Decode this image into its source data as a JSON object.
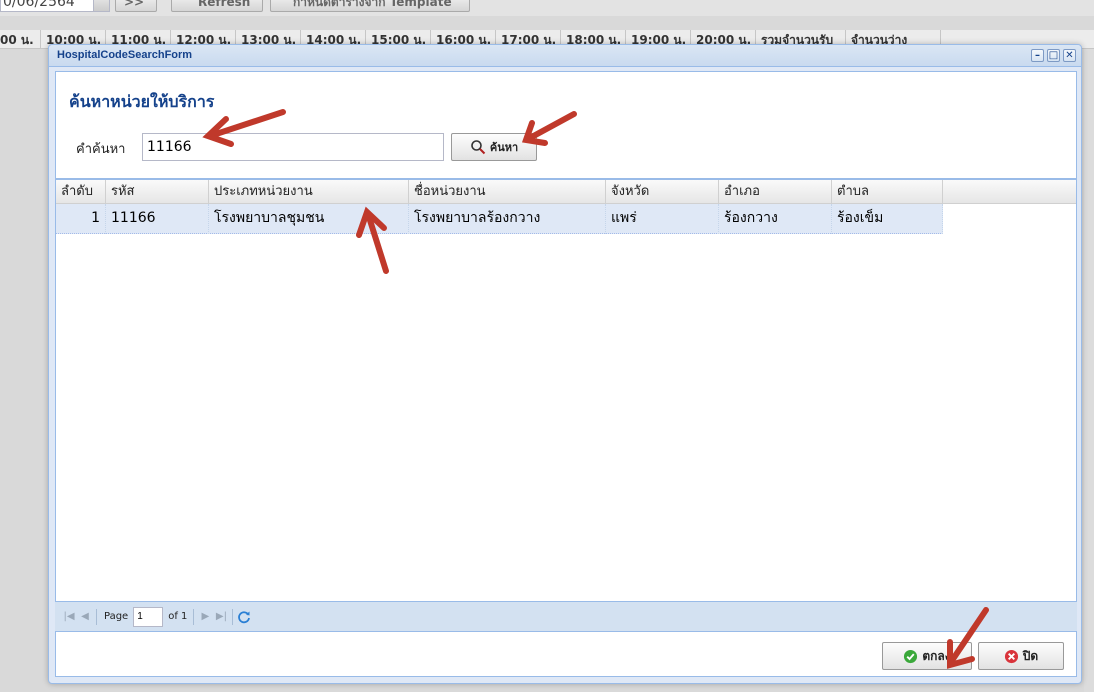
{
  "background": {
    "date_value": "0/06/2564",
    "next_label": ">>",
    "refresh_label": "Refresh",
    "template_label": "กำหนดตารางจาก Template",
    "hours": [
      "00 น.",
      "10:00 น.",
      "11:00 น.",
      "12:00 น.",
      "13:00 น.",
      "14:00 น.",
      "15:00 น.",
      "16:00 น.",
      "17:00 น.",
      "18:00 น.",
      "19:00 น.",
      "20:00 น.",
      "รวมจำนวนรับ",
      "จำนวนว่าง"
    ]
  },
  "window": {
    "title": "HospitalCodeSearchForm",
    "heading": "ค้นหาหน่วยให้บริการ",
    "search": {
      "label": "คำค้นหา",
      "value": "11166",
      "button_label": "ค้นหา"
    },
    "grid": {
      "columns": [
        "ลำดับ",
        "รหัส",
        "ประเภทหน่วยงาน",
        "ชื่อหน่วยงาน",
        "จังหวัด",
        "อำเภอ",
        "ตำบล"
      ],
      "rows": [
        {
          "no": "1",
          "code": "11166",
          "type": "โรงพยาบาลชุมชน",
          "name": "โรงพยาบาลร้องกวาง",
          "province": "แพร่",
          "district": "ร้องกวาง",
          "subdistrict": "ร้องเข็ม"
        }
      ]
    },
    "pager": {
      "page_label": "Page",
      "page_value": "1",
      "of_label": "of 1"
    },
    "footer": {
      "ok_label": "ตกลง",
      "close_label": "ปิด"
    }
  },
  "colors": {
    "title_blue": "#15428b",
    "selected_row": "#dfe8f6",
    "annotation_arrow": "#c0392b",
    "ok_icon": "#3aa83a",
    "close_icon": "#d9343b"
  }
}
